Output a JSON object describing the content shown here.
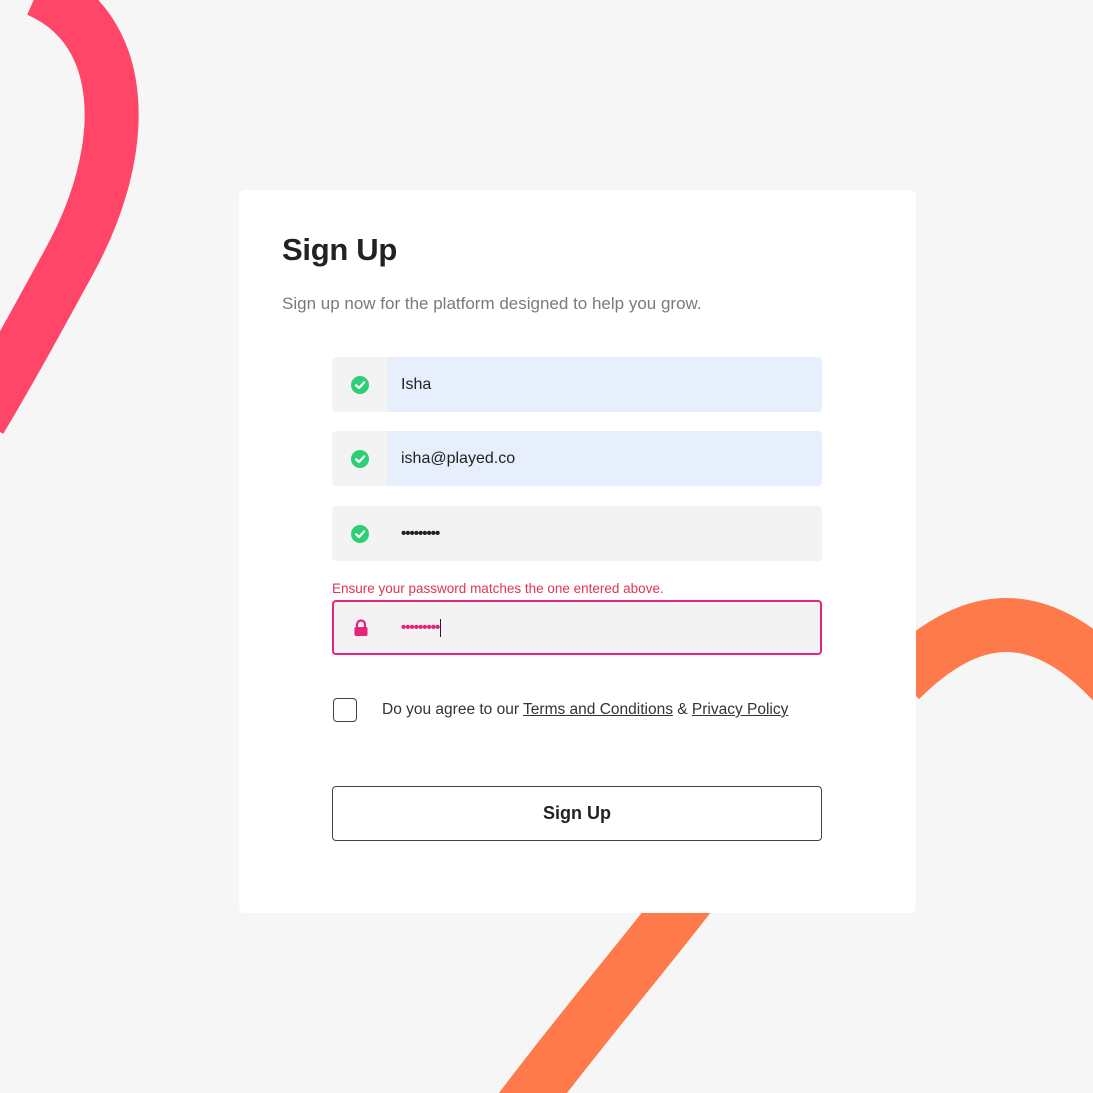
{
  "colors": {
    "background": "#f6f6f6",
    "card": "#ffffff",
    "success": "#2ecf74",
    "error": "#e8237a",
    "swoosh_pink": "#ff4668",
    "swoosh_orange": "#ff7a4a",
    "filled_field": "#e8effc"
  },
  "form": {
    "title": "Sign Up",
    "subtitle": "Sign up now for the platform designed to help you grow.",
    "fields": [
      {
        "icon": "check-circle-icon",
        "value": "Isha",
        "state": "valid"
      },
      {
        "icon": "check-circle-icon",
        "value": "isha@played.co",
        "state": "valid"
      },
      {
        "icon": "check-circle-icon",
        "value": "•••••••••",
        "state": "valid"
      },
      {
        "icon": "lock-icon",
        "value": "•••••••••",
        "state": "error"
      }
    ],
    "error_message": "Ensure your password matches the one entered above.",
    "agree": {
      "prefix": "Do you agree to our ",
      "terms_link": "Terms and Conditions",
      "connector": " & ",
      "privacy_link": "Privacy Policy",
      "checked": false
    },
    "submit_label": "Sign Up"
  }
}
